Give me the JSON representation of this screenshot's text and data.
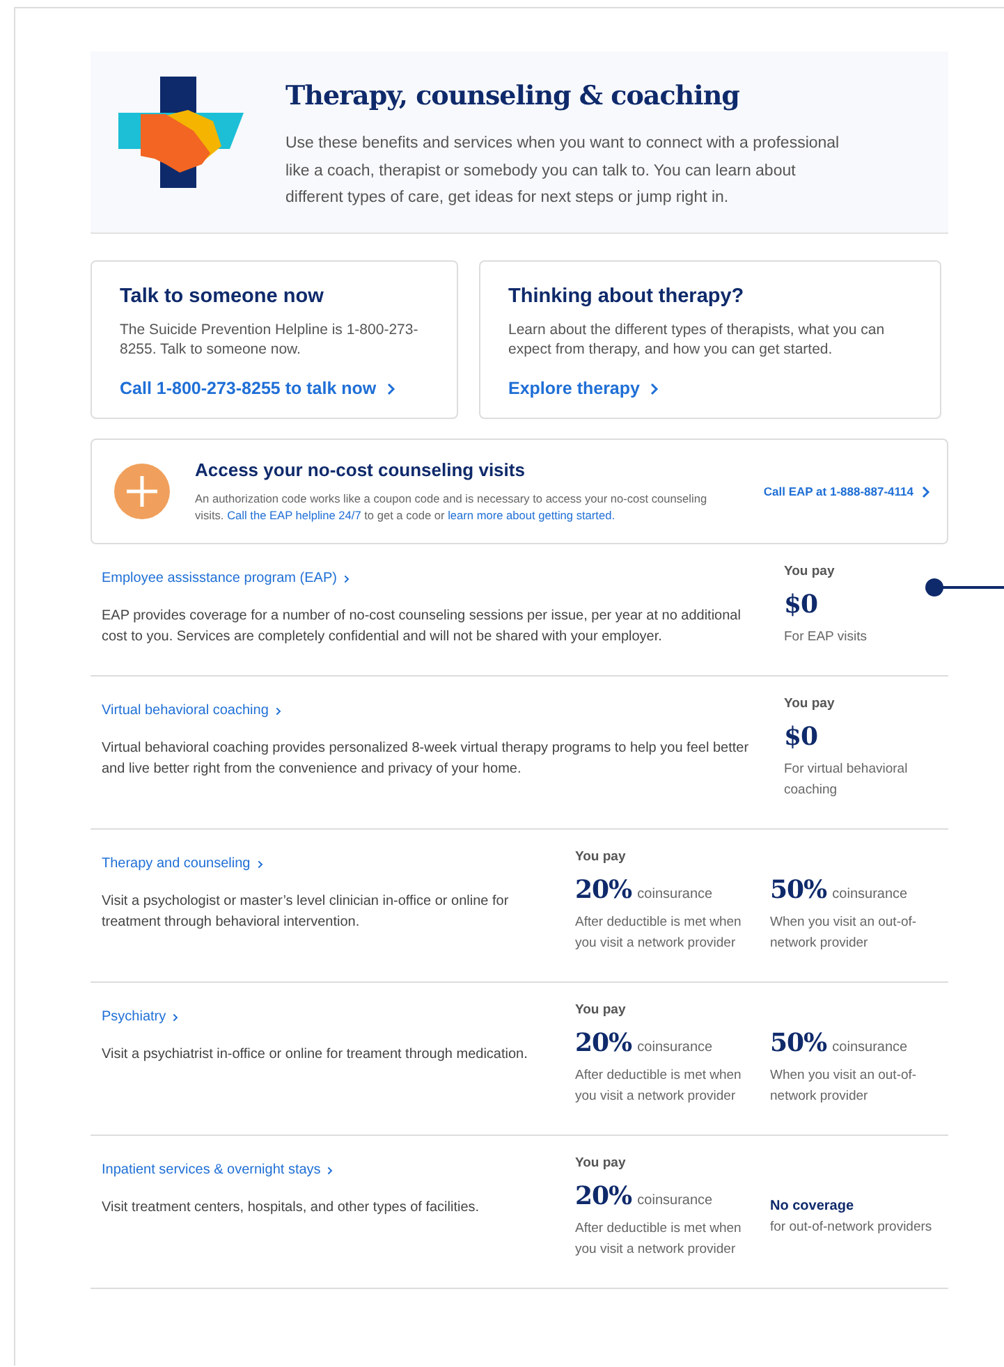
{
  "header": {
    "title": "Therapy, counseling & coaching",
    "description": "Use these benefits and services when you want to connect with a professional like a coach, therapist or somebody you can talk to. You can learn about different types of care, get ideas for next steps or jump right in."
  },
  "cards": [
    {
      "title": "Talk to someone now",
      "body": "The Suicide Prevention Helpline is 1-800-273-8255. Talk to someone now.",
      "link": "Call 1-800-273-8255 to talk now"
    },
    {
      "title": "Thinking about therapy?",
      "body": "Learn about the different types of therapists, what you can expect from therapy, and how you can get started.",
      "link": "Explore therapy"
    }
  ],
  "banner": {
    "title": "Access your no-cost counseling visits",
    "segments": [
      {
        "kind": "text",
        "text": "An authorization code works like a coupon code and is necessary to access your no-cost counseling visits. "
      },
      {
        "kind": "link",
        "text": "Call the EAP helpline 24/7"
      },
      {
        "kind": "text",
        "text": " to get a code or "
      },
      {
        "kind": "link",
        "text": "learn more about getting started."
      }
    ],
    "action": "Call EAP at 1-888-887-4114"
  },
  "benefits": [
    {
      "kind": "single",
      "title": "Employee assisstance program (EAP)",
      "description": "EAP provides coverage for a number of no-cost counseling sessions per issue, per year at no additional cost to you. Services are completely confidential and will not be shared with your employer.",
      "you_pay": "You pay",
      "connector": true,
      "costs": [
        {
          "kind": "amount",
          "amount": "$0",
          "note": "For EAP visits"
        }
      ]
    },
    {
      "kind": "single",
      "title": "Virtual behavioral coaching",
      "description": "Virtual behavioral coaching provides personalized 8-week virtual therapy programs to help you feel better and live better right from the convenience and privacy of your home.",
      "you_pay": "You pay",
      "connector": false,
      "costs": [
        {
          "kind": "amount",
          "amount": "$0",
          "note": "For virtual behavioral coaching"
        }
      ]
    },
    {
      "kind": "split",
      "title": "Therapy and counseling",
      "description": "Visit a psychologist or master’s level clinician in-office or online for treatment through behavioral intervention.",
      "you_pay": "You pay",
      "connector": false,
      "costs": [
        {
          "kind": "amount",
          "amount": "20%",
          "unit": "coinsurance",
          "note": "After deductible is met when you visit a network provider"
        },
        {
          "kind": "amount",
          "amount": "50%",
          "unit": "coinsurance",
          "note": "When you visit an out-of-network provider"
        }
      ]
    },
    {
      "kind": "split",
      "title": "Psychiatry",
      "description": "Visit a psychiatrist in-office or online for treament through medication.",
      "you_pay": "You pay",
      "connector": false,
      "costs": [
        {
          "kind": "amount",
          "amount": "20%",
          "unit": "coinsurance",
          "note": "After deductible is met when you visit a network provider"
        },
        {
          "kind": "amount",
          "amount": "50%",
          "unit": "coinsurance",
          "note": "When you visit an out-of-network provider"
        }
      ]
    },
    {
      "kind": "split",
      "title": "Inpatient services & overnight stays",
      "description": "Visit treatment centers, hospitals, and other types of facilities.",
      "you_pay": "You pay",
      "connector": false,
      "costs": [
        {
          "kind": "amount",
          "amount": "20%",
          "unit": "coinsurance",
          "note": "After deductible is met when you visit a network provider"
        },
        {
          "kind": "none",
          "heading": "No coverage",
          "note": "for out-of-network providers"
        }
      ]
    }
  ]
}
